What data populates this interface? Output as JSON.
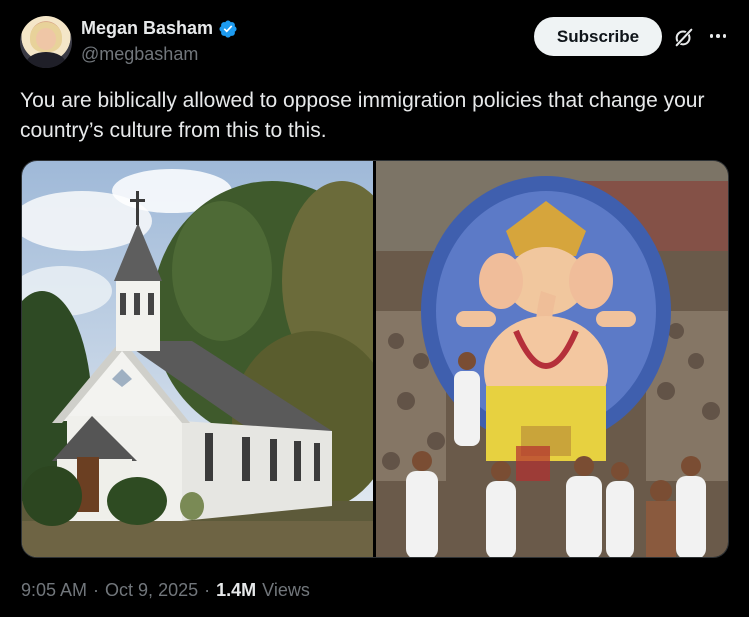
{
  "author": {
    "name": "Megan Basham",
    "handle": "@megbasham",
    "verified": true
  },
  "actions": {
    "subscribe_label": "Subscribe",
    "grok_icon": "grok-icon",
    "more_icon": "more-dots-icon"
  },
  "tweet": {
    "text": "You are biblically allowed to oppose immigration policies that change your country’s culture from this to this."
  },
  "media": {
    "left_image": "white country church with steeple among trees",
    "right_image": "large Ganesha idol carried through crowd at festival"
  },
  "footer": {
    "time": "9:05 AM",
    "sep1": "·",
    "date": "Oct 9, 2025",
    "sep2": "·",
    "views_count": "1.4M",
    "views_label": "Views"
  },
  "colors": {
    "background": "#000000",
    "text": "#e7e9ea",
    "muted": "#71767b",
    "verified": "#1d9bf0",
    "button_bg": "#eff3f4"
  }
}
